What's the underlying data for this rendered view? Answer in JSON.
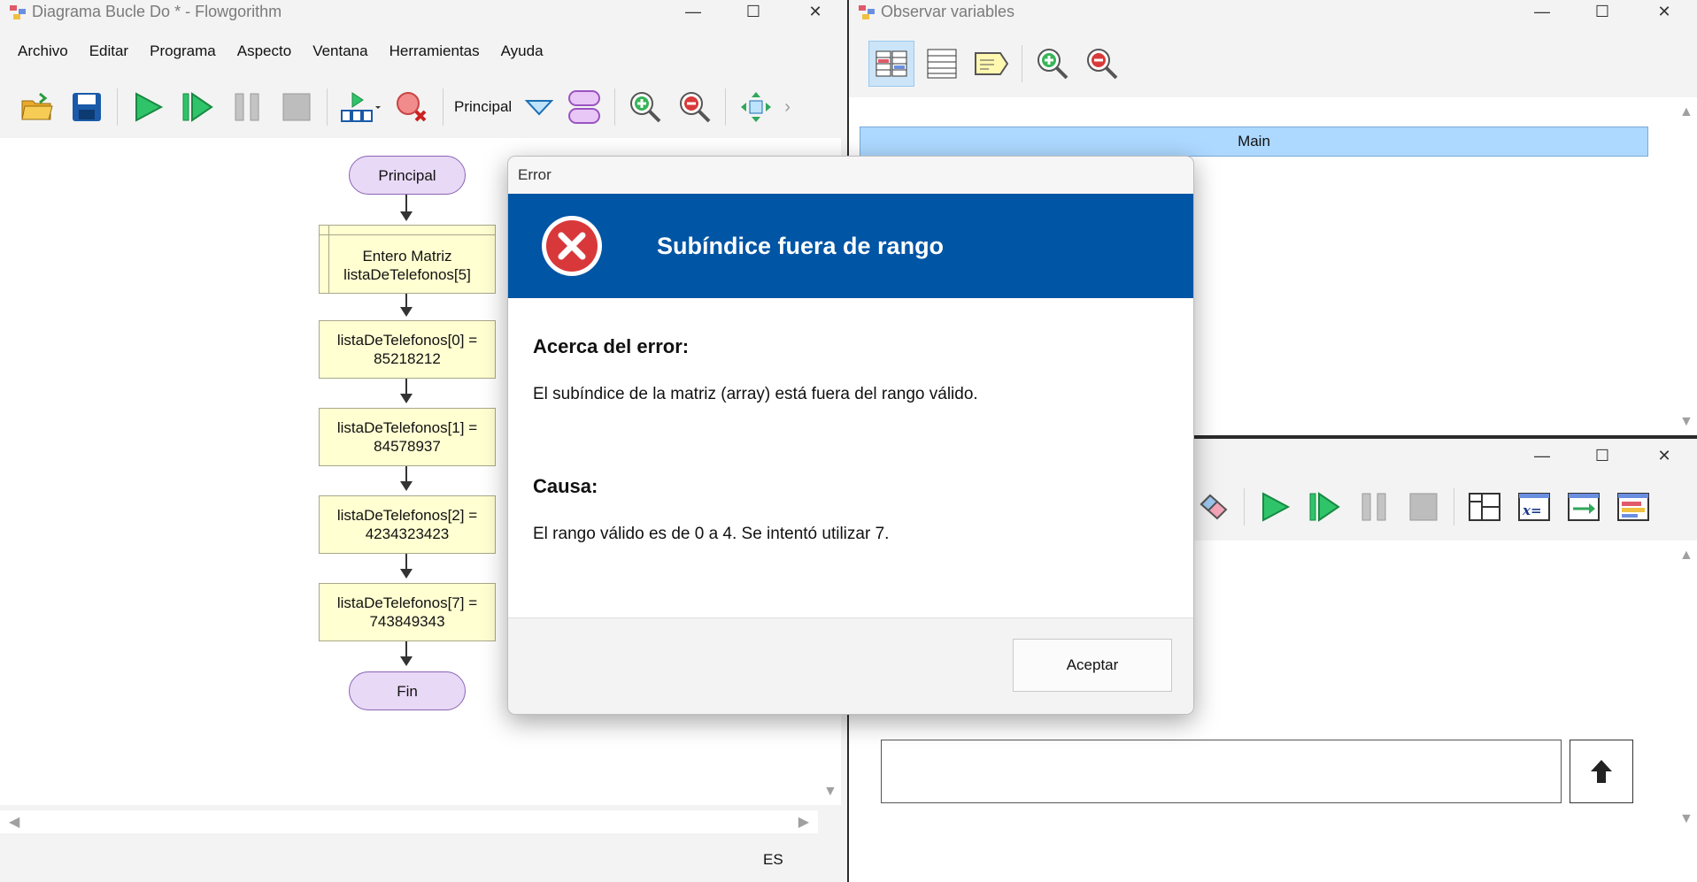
{
  "main_window": {
    "title": "Diagrama Bucle Do * - Flowgorithm",
    "menu": [
      "Archivo",
      "Editar",
      "Programa",
      "Aspecto",
      "Ventana",
      "Herramientas",
      "Ayuda"
    ],
    "function_selector": "Principal",
    "flowchart": {
      "start": "Principal",
      "declare": [
        "Entero Matriz",
        "listaDeTelefonos[5]"
      ],
      "assignments": [
        [
          "listaDeTelefonos[0] =",
          "85218212"
        ],
        [
          "listaDeTelefonos[1] =",
          "84578937"
        ],
        [
          "listaDeTelefonos[2] =",
          "4234323423"
        ],
        [
          "listaDeTelefonos[7] =",
          "743849343"
        ]
      ],
      "end": "Fin"
    },
    "status_language": "ES"
  },
  "watch_window": {
    "title": "Observar variables",
    "header": "Main"
  },
  "console_window": {
    "input_value": "",
    "submit_icon": "arrow-up-icon"
  },
  "dialog": {
    "title": "Error",
    "heading": "Subíndice fuera de rango",
    "about_label": "Acerca del error:",
    "about_text": "El subíndice de la matriz (array) está fuera del rango válido.",
    "cause_label": "Causa:",
    "cause_text": "El rango válido es de 0 a 4. Se intentó utilizar 7.",
    "ok_button": "Aceptar",
    "icon": "error-x-icon"
  },
  "colors": {
    "dialog_header": "#0055a5",
    "error_icon": "#d8383a",
    "terminal_node": "#e8d9f6",
    "process_node": "#ffffd2",
    "watch_header": "#add8ff"
  }
}
